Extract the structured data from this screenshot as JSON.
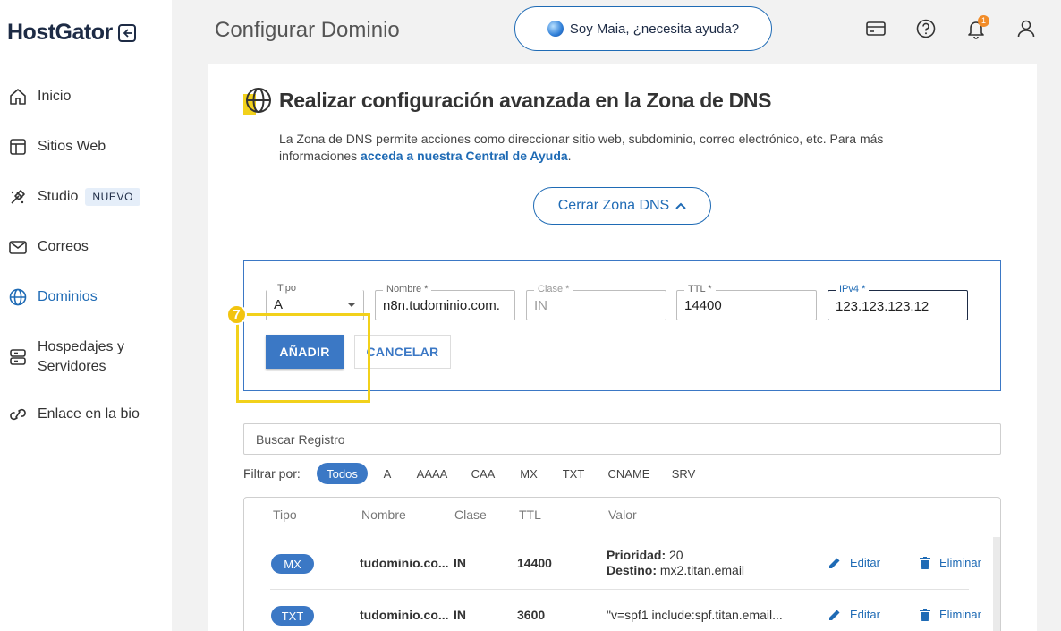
{
  "brand": {
    "logo": "HostGator"
  },
  "sidebar": {
    "items": [
      {
        "label": "Inicio",
        "icon": "home-icon"
      },
      {
        "label": "Sitios Web",
        "icon": "website-icon"
      },
      {
        "label": "Studio",
        "icon": "studio-icon",
        "badge": "NUEVO"
      },
      {
        "label": "Correos",
        "icon": "mail-icon"
      },
      {
        "label": "Dominios",
        "icon": "globe-icon",
        "active": true
      },
      {
        "label_line1": "Hospedajes y",
        "label_line2": "Servidores",
        "icon": "server-icon"
      },
      {
        "label": "Enlace en la bio",
        "icon": "link-icon"
      }
    ]
  },
  "header": {
    "title": "Configurar Dominio",
    "assistant": "Soy Maia, ¿necesita ayuda?",
    "notification_count": "1"
  },
  "dns": {
    "title": "Realizar configuración avanzada en la Zona de DNS",
    "desc_before": "La Zona de DNS permite acciones como direccionar sitio web, subdominio, correo electrónico, etc. Para más informaciones ",
    "desc_link": "acceda a nuestra Central de Ayuda",
    "desc_after": ".",
    "close_button": "Cerrar Zona DNS"
  },
  "form": {
    "tipo": {
      "label": "Tipo",
      "value": "A"
    },
    "nombre": {
      "label": "Nombre *",
      "value": "n8n.tudominio.com."
    },
    "clase": {
      "label": "Clase *",
      "value": "IN"
    },
    "ttl": {
      "label": "TTL *",
      "value": "14400"
    },
    "ipv4": {
      "label": "IPv4 *",
      "value": "123.123.123.12"
    },
    "add_button": "AÑADIR",
    "cancel_button": "CANCELAR",
    "step_number": "7"
  },
  "search": {
    "placeholder": "Buscar Registro"
  },
  "filters": {
    "label": "Filtrar por:",
    "options": [
      "Todos",
      "A",
      "AAAA",
      "CAA",
      "MX",
      "TXT",
      "CNAME",
      "SRV"
    ],
    "selected": "Todos"
  },
  "table": {
    "headers": [
      "Tipo",
      "Nombre",
      "Clase",
      "TTL",
      "Valor"
    ],
    "rows": [
      {
        "type": "MX",
        "name": "tudominio.co...",
        "class": "IN",
        "ttl": "14400",
        "priority_label": "Prioridad:",
        "priority": "20",
        "dest_label": "Destino:",
        "dest": "mx2.titan.email",
        "edit": "Editar",
        "delete": "Eliminar"
      },
      {
        "type": "TXT",
        "name": "tudominio.co...",
        "class": "IN",
        "ttl": "3600",
        "value": "\"v=spf1 include:spf.titan.email...",
        "edit": "Editar",
        "delete": "Eliminar"
      }
    ]
  },
  "colors": {
    "primary": "#3b78c5",
    "highlight": "#f2d11b",
    "brand_dark": "#1d2b45"
  }
}
